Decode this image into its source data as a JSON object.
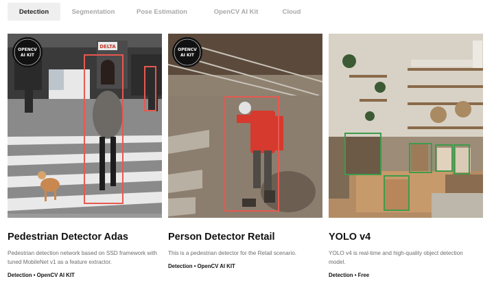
{
  "tabs": [
    {
      "label": "Detection",
      "active": true
    },
    {
      "label": "Segmentation",
      "active": false
    },
    {
      "label": "Pose Estimation",
      "active": false
    },
    {
      "label": "OpenCV AI Kit",
      "active": false
    },
    {
      "label": "Cloud",
      "active": false
    }
  ],
  "cards": [
    {
      "title": "Pedestrian Detector Adas",
      "description": "Pedestrian detection network based on SSD framework with tuned MobileNet v1 as a feature extractor.",
      "tags": "Detection • OpenCV AI KIT",
      "badge_line1": "OPENCV",
      "badge_line2": "AI KIT",
      "sign": "DELTA",
      "box_color": "#e8584f"
    },
    {
      "title": "Person Detector Retail",
      "description": "This is a pedestrian detector for the Retail scenario.",
      "tags": "Detection • OpenCV AI KIT",
      "badge_line1": "OPENCV",
      "badge_line2": "AI KIT",
      "box_color": "#e8584f"
    },
    {
      "title": "YOLO v4",
      "description": "YOLO v4 is real-time and high-quality object detection model.",
      "tags": "Detection • Free",
      "box_color": "#3f9b4a"
    }
  ]
}
